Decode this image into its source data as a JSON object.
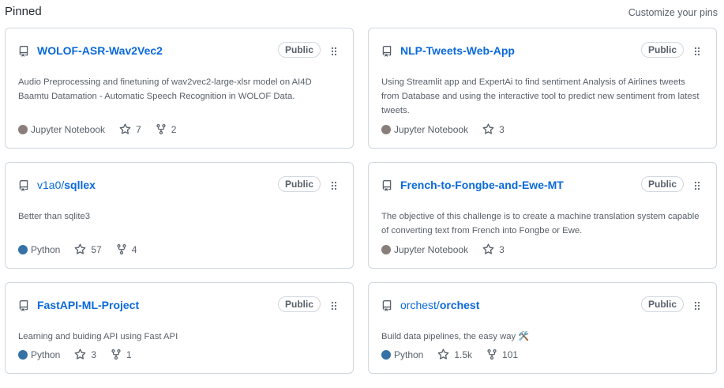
{
  "header": {
    "title": "Pinned",
    "customize_label": "Customize your pins"
  },
  "colors": {
    "link": "#0969da",
    "jupyter": "#8a7e7a",
    "python": "#3572A5",
    "border": "#d0d7de",
    "muted": "#57606a"
  },
  "cards": [
    {
      "name": "WOLOF-ASR-Wav2Vec2",
      "owner": "",
      "visibility": "Public",
      "description": "Audio Preprocessing and finetuning of wav2vec2-large-xlsr model on AI4D Baamtu Datamation - Automatic Speech Recognition in WOLOF Data.",
      "language": "Jupyter Notebook",
      "language_color": "#8a7e7a",
      "stars": "7",
      "forks": "2"
    },
    {
      "name": "NLP-Tweets-Web-App",
      "owner": "",
      "visibility": "Public",
      "description": "Using Streamlit app and ExpertAi to find sentiment Analysis of Airlines tweets from Database and using the interactive tool to predict new sentiment from latest tweets.",
      "language": "Jupyter Notebook",
      "language_color": "#8a7e7a",
      "stars": "3",
      "forks": ""
    },
    {
      "name": "sqllex",
      "owner": "v1a0/",
      "visibility": "Public",
      "description": "Better than sqlite3",
      "language": "Python",
      "language_color": "#3572A5",
      "stars": "57",
      "forks": "4"
    },
    {
      "name": "French-to-Fongbe-and-Ewe-MT",
      "owner": "",
      "visibility": "Public",
      "description": "The objective of this challenge is to create a machine translation system capable of converting text from French into Fongbe or Ewe.",
      "language": "Jupyter Notebook",
      "language_color": "#8a7e7a",
      "stars": "3",
      "forks": ""
    },
    {
      "name": "FastAPI-ML-Project",
      "owner": "",
      "visibility": "Public",
      "description": "Learning and buiding API using Fast API",
      "language": "Python",
      "language_color": "#3572A5",
      "stars": "3",
      "forks": "1"
    },
    {
      "name": "orchest",
      "owner": "orchest/",
      "visibility": "Public",
      "description": "Build data pipelines, the easy way 🛠️",
      "language": "Python",
      "language_color": "#3572A5",
      "stars": "1.5k",
      "forks": "101"
    }
  ]
}
